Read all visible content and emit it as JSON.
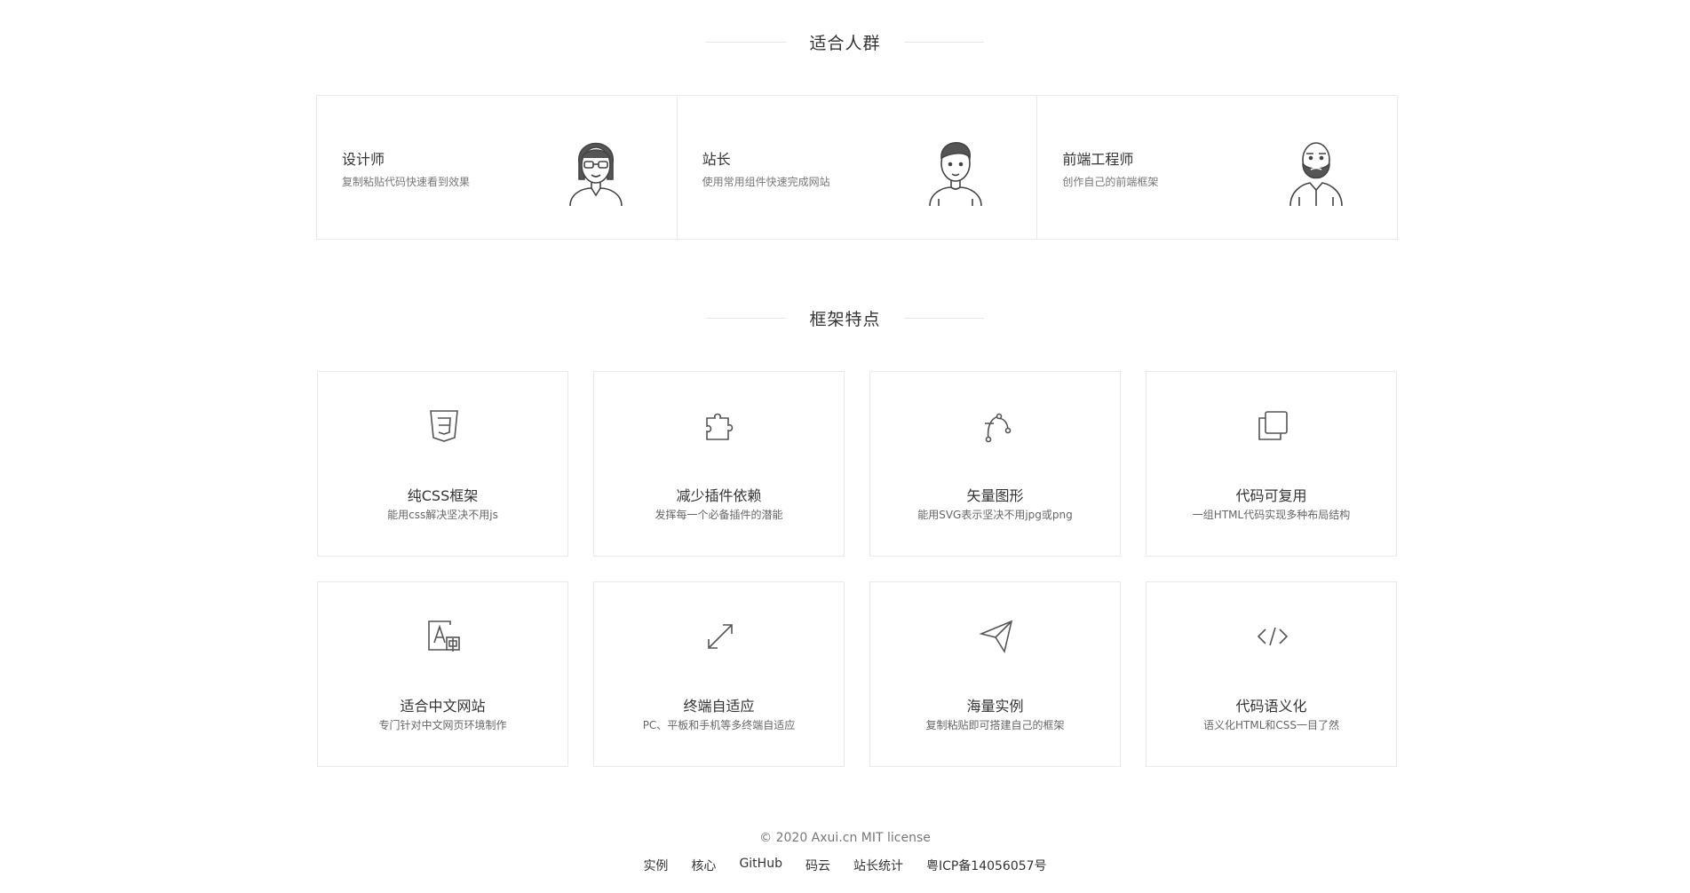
{
  "sections": {
    "users_title": "适合人群",
    "features_title": "框架特点"
  },
  "users": [
    {
      "title": "设计师",
      "desc": "复制粘贴代码快速看到效果",
      "icon": "woman-glasses-avatar-icon"
    },
    {
      "title": "站长",
      "desc": "使用常用组件快速完成网站",
      "icon": "man-avatar-icon"
    },
    {
      "title": "前端工程师",
      "desc": "创作自己的前端框架",
      "icon": "bearded-man-avatar-icon"
    }
  ],
  "features": [
    {
      "title": "纯CSS框架",
      "desc": "能用css解决坚决不用js",
      "icon": "css3-shield-icon"
    },
    {
      "title": "减少插件依赖",
      "desc": "发挥每一个必备插件的潜能",
      "icon": "puzzle-piece-icon"
    },
    {
      "title": "矢量图形",
      "desc": "能用SVG表示坚决不用jpg或png",
      "icon": "bezier-curve-icon"
    },
    {
      "title": "代码可复用",
      "desc": "一组HTML代码实现多种布局结构",
      "icon": "copy-layers-icon"
    },
    {
      "title": "适合中文网站",
      "desc": "专门针对中文网页环境制作",
      "icon": "translate-icon"
    },
    {
      "title": "终端自适应",
      "desc": "PC、平板和手机等多终端自适应",
      "icon": "expand-arrows-icon"
    },
    {
      "title": "海量实例",
      "desc": "复制粘贴即可搭建自己的框架",
      "icon": "paper-plane-icon"
    },
    {
      "title": "代码语义化",
      "desc": "语义化HTML和CSS一目了然",
      "icon": "code-brackets-icon"
    }
  ],
  "footer": {
    "copyright": "© 2020 Axui.cn MIT license",
    "links": [
      "实例",
      "核心",
      "GitHub",
      "码云",
      "站长统计",
      "粤ICP备14056057号"
    ]
  }
}
